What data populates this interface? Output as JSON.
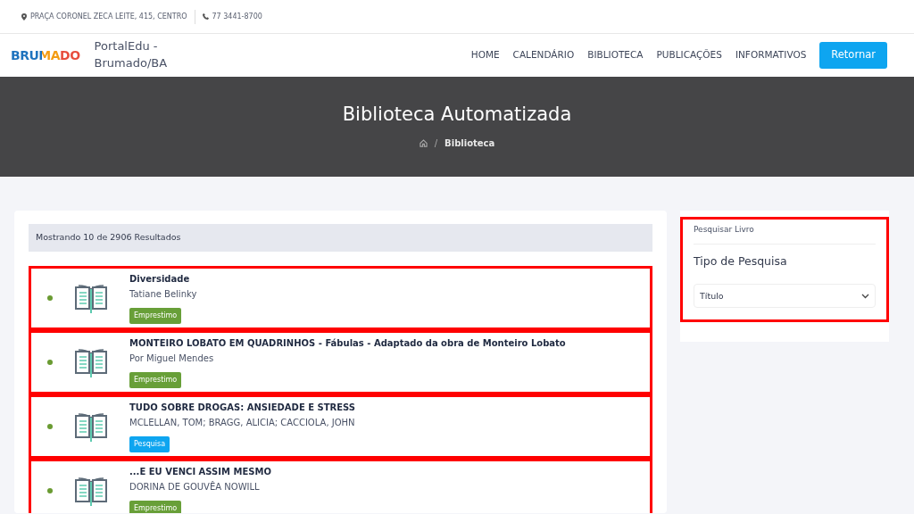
{
  "topbar": {
    "address": "PRAÇA CORONEL ZECA LEITE, 415, CENTRO",
    "phone": "77 3441-8700"
  },
  "navbar": {
    "logo_text": "BRUMADO",
    "brand": "PortalEdu - Brumado/BA",
    "links": [
      {
        "label": "HOME"
      },
      {
        "label": "CALENDÁRIO"
      },
      {
        "label": "BIBLIOTECA"
      },
      {
        "label": "PUBLICAÇÕES"
      },
      {
        "label": "INFORMATIVOS"
      }
    ],
    "button": "Retornar"
  },
  "hero": {
    "title": "Biblioteca Automatizada",
    "breadcrumb_separator": "/",
    "breadcrumb": "Biblioteca"
  },
  "results": {
    "summary": "Mostrando 10 de 2906 Resultados",
    "items": [
      {
        "title": "Diversidade",
        "author": "Tatiane Belinky",
        "tag": {
          "label": "Emprestimo",
          "kind": "loan"
        },
        "highlighted": true
      },
      {
        "title": "MONTEIRO LOBATO EM QUADRINHOS - Fábulas - Adaptado da obra de Monteiro Lobato",
        "author": "Por Miguel Mendes",
        "tag": {
          "label": "Emprestimo",
          "kind": "loan"
        },
        "highlighted": true
      },
      {
        "title": "TUDO SOBRE DROGAS: ANSIEDADE E STRESS",
        "author": "MCLELLAN, TOM; BRAGG, ALICIA; CACCIOLA, JOHN",
        "tag": {
          "label": "Pesquisa",
          "kind": "research"
        },
        "highlighted": true
      },
      {
        "title": "...E EU VENCI ASSIM MESMO",
        "author": "DORINA DE GOUVÊA NOWILL",
        "tag": {
          "label": "Emprestimo",
          "kind": "loan"
        },
        "highlighted": true
      }
    ]
  },
  "search_panel": {
    "header": "Pesquisar Livro",
    "heading": "Tipo de Pesquisa",
    "select_value": "Título",
    "highlighted": true
  }
}
